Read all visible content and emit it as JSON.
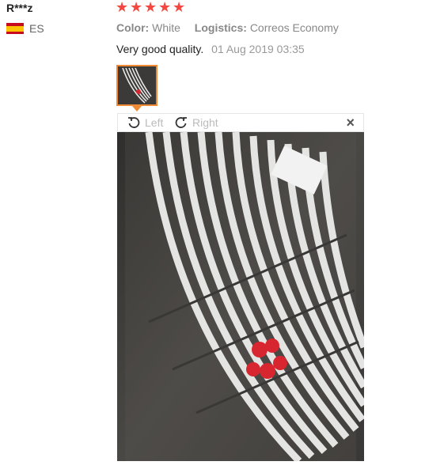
{
  "review": {
    "user_name": "R***z",
    "country_code": "ES",
    "rating": "★★★★★",
    "color_label": "Color:",
    "color_value": "White",
    "logistics_label": "Logistics:",
    "logistics_value": "Correos Economy",
    "feedback_text": "Very good quality.",
    "date": "01 Aug 2019 03:35"
  },
  "viewer": {
    "rotate_left_label": "Left",
    "rotate_right_label": "Right",
    "close_label": "×"
  },
  "colors": {
    "star": "#f5473f",
    "thumb_border": "#f08a35",
    "flag_red": "#c60b1e",
    "flag_yellow": "#ffc400"
  }
}
